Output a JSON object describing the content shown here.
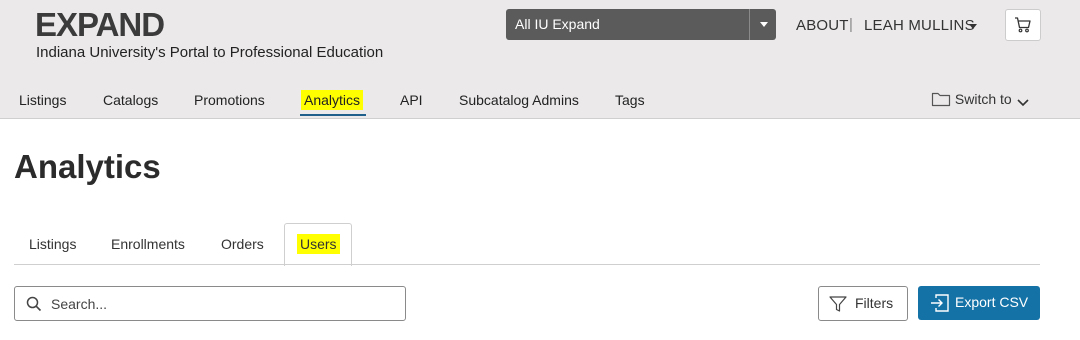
{
  "header": {
    "logo": "EXPAND",
    "tagline": "Indiana University's Portal to Professional Education",
    "scope_select": "All IU Expand",
    "about": "ABOUT",
    "separator": "|",
    "user_name": "LEAH MULLINS"
  },
  "nav": {
    "items": [
      "Listings",
      "Catalogs",
      "Promotions",
      "Analytics",
      "API",
      "Subcatalog Admins",
      "Tags"
    ],
    "active": "Analytics",
    "switch_to": "Switch to"
  },
  "page": {
    "title": "Analytics",
    "tabs": [
      "Listings",
      "Enrollments",
      "Orders",
      "Users"
    ],
    "active_tab": "Users",
    "search_placeholder": "Search...",
    "filters_label": "Filters",
    "export_label": "Export CSV"
  },
  "colors": {
    "highlight": "#ffff00",
    "primary_button": "#1572a6",
    "topbar_bg": "#ebe9ea"
  }
}
